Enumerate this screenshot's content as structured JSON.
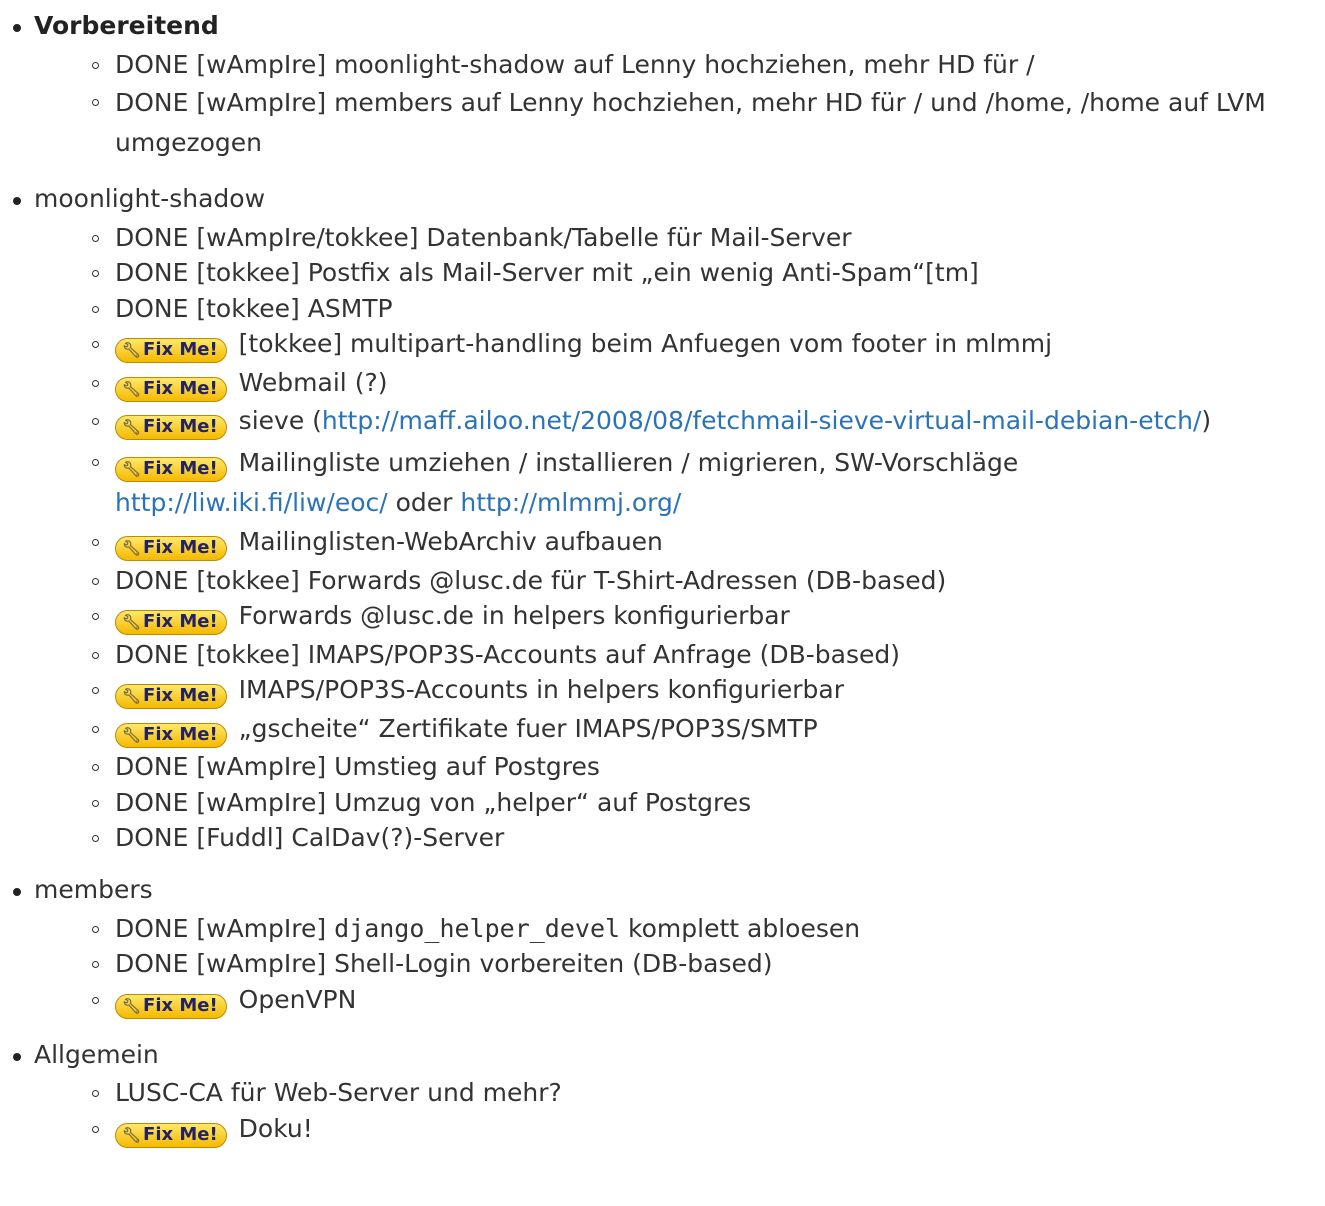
{
  "fixme_label": "Fix Me!",
  "fixme_icon": "wrench-icon",
  "sections": [
    {
      "title": "Vorbereitend",
      "items": [
        {
          "text": "DONE [wAmpIre] moonlight-shadow auf Lenny hochziehen, mehr HD für /"
        },
        {
          "text": "DONE [wAmpIre] members auf Lenny hochziehen, mehr HD für / und /home, /home auf LVM umgezogen"
        }
      ]
    },
    {
      "title": "moonlight-shadow",
      "items": [
        {
          "text": "DONE [wAmpIre/tokkee] Datenbank/Tabelle für Mail-Server"
        },
        {
          "text": "DONE [tokkee] Postfix als Mail-Server mit „ein wenig Anti-Spam“[tm]"
        },
        {
          "text": "DONE [tokkee] ASMTP"
        },
        {
          "text": "[tokkee] multipart-handling beim Anfuegen vom footer in mlmmj"
        },
        {
          "text": "Webmail (?)"
        },
        {
          "text_before": "sieve (",
          "link": "http://maff.ailoo.net/2008/08/fetchmail-sieve-virtual-mail-debian-etch/",
          "text_after": ")"
        },
        {
          "text": "Mailingliste umziehen / installieren / migrieren, SW-Vorschläge",
          "link1": "http://liw.iki.fi/liw/eoc/",
          "between": "oder",
          "link2": "http://mlmmj.org/"
        },
        {
          "text": "Mailinglisten-WebArchiv aufbauen"
        },
        {
          "text": "DONE [tokkee] Forwards @lusc.de für T-Shirt-Adressen (DB-based)"
        },
        {
          "text": "Forwards @lusc.de in helpers konfigurierbar"
        },
        {
          "text": "DONE [tokkee] IMAPS/POP3S-Accounts auf Anfrage (DB-based)"
        },
        {
          "text": "IMAPS/POP3S-Accounts in helpers konfigurierbar"
        },
        {
          "text": "„gscheite“ Zertifikate fuer IMAPS/POP3S/SMTP"
        },
        {
          "text": "DONE [wAmpIre] Umstieg auf Postgres"
        },
        {
          "text": "DONE [wAmpIre] Umzug von „helper“ auf Postgres"
        },
        {
          "text": "DONE [Fuddl] CalDav(?)-Server"
        }
      ]
    },
    {
      "title": "members",
      "items": [
        {
          "text_before": "DONE [wAmpIre]",
          "code": "django_helper_devel",
          "text_after": "komplett abloesen"
        },
        {
          "text": "DONE [wAmpIre] Shell-Login vorbereiten (DB-based)"
        },
        {
          "text": "OpenVPN"
        }
      ]
    },
    {
      "title": "Allgemein",
      "items": [
        {
          "text": "LUSC-CA für Web-Server und mehr?"
        },
        {
          "text": "Doku!"
        }
      ]
    }
  ]
}
